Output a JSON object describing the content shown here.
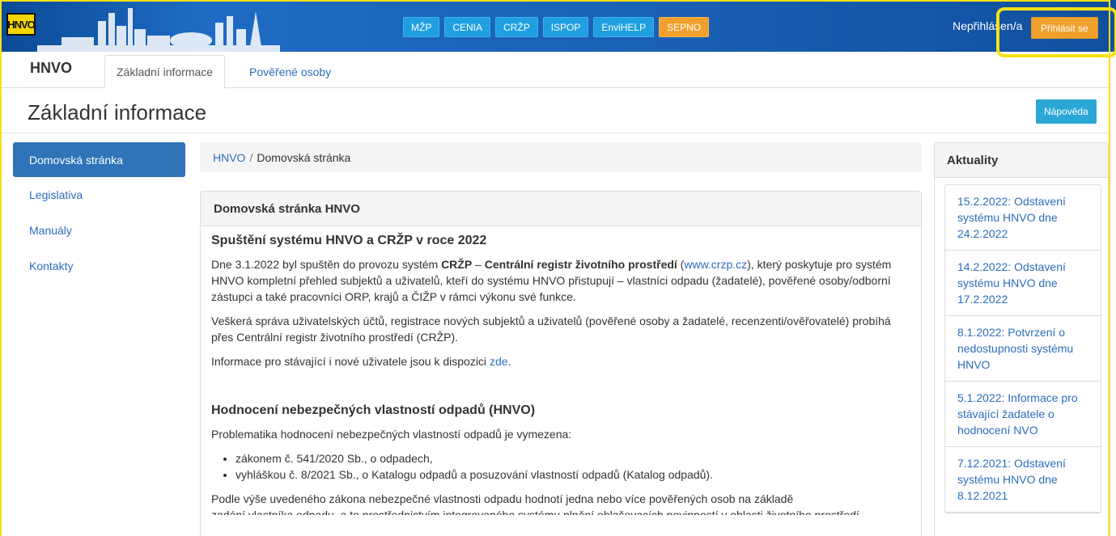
{
  "topbar": {
    "logo_text": "HNVO",
    "nav": [
      "MŽP",
      "CENIA",
      "CRŽP",
      "ISPOP",
      "EnviHELP",
      "SEPNO"
    ],
    "user_status": "Nepřihlášen/a",
    "login_label": "Přihlásit se",
    "colors": {
      "banner": "#1a5fb4",
      "nav_button": "#1f9fe0",
      "accent_orange": "#f0a02d",
      "highlight_yellow": "#f5e214"
    }
  },
  "tabs": {
    "brand": "HNVO",
    "items": [
      "Základní informace",
      "Pověřené osoby"
    ],
    "active": "Základní informace"
  },
  "header": {
    "title": "Základní informace",
    "help_label": "Nápověda"
  },
  "sidebar": {
    "items": [
      "Domovská stránka",
      "Legislativa",
      "Manuály",
      "Kontakty"
    ],
    "active": "Domovská stránka"
  },
  "breadcrumb": {
    "root": "HNVO",
    "separator": "/",
    "current": "Domovská stránka"
  },
  "main": {
    "panel_title": "Domovská stránka HNVO",
    "section1_title": "Spuštění systému HNVO a CRŽP v roce 2022",
    "p1_part1": "Dne 3.1.2022 byl spuštěn do provozu systém ",
    "p1_bold1": "CRŽP",
    "p1_dash": " – ",
    "p1_bold2": "Centrální registr životního prostředí",
    "p1_part2": " (",
    "p1_link": "www.crzp.cz",
    "p1_part3": "), který poskytuje pro systém HNVO kompletní přehled subjektů a uživatelů, kteří do systému HNVO přistupují – vlastníci odpadu (žadatelé), pověřené osoby/odborní zástupci a také pracovníci ORP, krajů a ČIŽP v rámci výkonu své funkce.",
    "p2": "Veškerá správa uživatelských účtů, registrace nových subjektů a uživatelů (pověřené osoby a žadatelé, recenzenti/ověřovatelé) probíhá přes Centrální registr životního prostředí (CRŽP).",
    "p3_text": "Informace pro stávající i nové uživatele jsou k dispozici ",
    "p3_link": "zde",
    "p3_end": ".",
    "section2_title": "Hodnocení nebezpečných vlastností odpadů (HNVO)",
    "p4": "Problematika hodnocení nebezpečných vlastností odpadů je vymezena:",
    "list": [
      "zákonem č. 541/2020 Sb., o odpadech,",
      "vyhláškou  č. 8/2021 Sb., o Katalogu odpadů a posuzování vlastností odpadů (Katalog odpadů)."
    ],
    "p5": "Podle výše uvedeného zákona nebezpečné vlastnosti odpadu hodnotí jedna nebo více pověřených osob na základě",
    "p6_clipped": "zadání vlastníka odpadu, a to prostřednictvím integrovaného systému plnění ohlašovacích povinností v oblasti životního prostředí"
  },
  "news": {
    "title": "Aktuality",
    "items": [
      "15.2.2022: Odstavení systému HNVO dne 24.2.2022",
      "14.2.2022: Odstavení systému HNVO dne 17.2.2022",
      "8.1.2022: Potvrzení o nedostupnosti systému HNVO",
      "5.1.2022: Informace pro stávající žadatele o hodnocení NVO",
      "7.12.2021: Odstavení systému HNVO dne 8.12.2021"
    ]
  }
}
